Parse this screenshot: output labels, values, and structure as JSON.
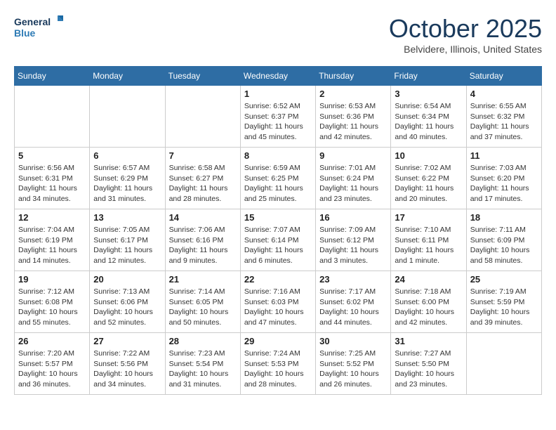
{
  "header": {
    "logo_line1": "General",
    "logo_line2": "Blue",
    "month": "October 2025",
    "location": "Belvidere, Illinois, United States"
  },
  "days_of_week": [
    "Sunday",
    "Monday",
    "Tuesday",
    "Wednesday",
    "Thursday",
    "Friday",
    "Saturday"
  ],
  "weeks": [
    [
      {
        "day": "",
        "info": ""
      },
      {
        "day": "",
        "info": ""
      },
      {
        "day": "",
        "info": ""
      },
      {
        "day": "1",
        "info": "Sunrise: 6:52 AM\nSunset: 6:37 PM\nDaylight: 11 hours\nand 45 minutes."
      },
      {
        "day": "2",
        "info": "Sunrise: 6:53 AM\nSunset: 6:36 PM\nDaylight: 11 hours\nand 42 minutes."
      },
      {
        "day": "3",
        "info": "Sunrise: 6:54 AM\nSunset: 6:34 PM\nDaylight: 11 hours\nand 40 minutes."
      },
      {
        "day": "4",
        "info": "Sunrise: 6:55 AM\nSunset: 6:32 PM\nDaylight: 11 hours\nand 37 minutes."
      }
    ],
    [
      {
        "day": "5",
        "info": "Sunrise: 6:56 AM\nSunset: 6:31 PM\nDaylight: 11 hours\nand 34 minutes."
      },
      {
        "day": "6",
        "info": "Sunrise: 6:57 AM\nSunset: 6:29 PM\nDaylight: 11 hours\nand 31 minutes."
      },
      {
        "day": "7",
        "info": "Sunrise: 6:58 AM\nSunset: 6:27 PM\nDaylight: 11 hours\nand 28 minutes."
      },
      {
        "day": "8",
        "info": "Sunrise: 6:59 AM\nSunset: 6:25 PM\nDaylight: 11 hours\nand 25 minutes."
      },
      {
        "day": "9",
        "info": "Sunrise: 7:01 AM\nSunset: 6:24 PM\nDaylight: 11 hours\nand 23 minutes."
      },
      {
        "day": "10",
        "info": "Sunrise: 7:02 AM\nSunset: 6:22 PM\nDaylight: 11 hours\nand 20 minutes."
      },
      {
        "day": "11",
        "info": "Sunrise: 7:03 AM\nSunset: 6:20 PM\nDaylight: 11 hours\nand 17 minutes."
      }
    ],
    [
      {
        "day": "12",
        "info": "Sunrise: 7:04 AM\nSunset: 6:19 PM\nDaylight: 11 hours\nand 14 minutes."
      },
      {
        "day": "13",
        "info": "Sunrise: 7:05 AM\nSunset: 6:17 PM\nDaylight: 11 hours\nand 12 minutes."
      },
      {
        "day": "14",
        "info": "Sunrise: 7:06 AM\nSunset: 6:16 PM\nDaylight: 11 hours\nand 9 minutes."
      },
      {
        "day": "15",
        "info": "Sunrise: 7:07 AM\nSunset: 6:14 PM\nDaylight: 11 hours\nand 6 minutes."
      },
      {
        "day": "16",
        "info": "Sunrise: 7:09 AM\nSunset: 6:12 PM\nDaylight: 11 hours\nand 3 minutes."
      },
      {
        "day": "17",
        "info": "Sunrise: 7:10 AM\nSunset: 6:11 PM\nDaylight: 11 hours\nand 1 minute."
      },
      {
        "day": "18",
        "info": "Sunrise: 7:11 AM\nSunset: 6:09 PM\nDaylight: 10 hours\nand 58 minutes."
      }
    ],
    [
      {
        "day": "19",
        "info": "Sunrise: 7:12 AM\nSunset: 6:08 PM\nDaylight: 10 hours\nand 55 minutes."
      },
      {
        "day": "20",
        "info": "Sunrise: 7:13 AM\nSunset: 6:06 PM\nDaylight: 10 hours\nand 52 minutes."
      },
      {
        "day": "21",
        "info": "Sunrise: 7:14 AM\nSunset: 6:05 PM\nDaylight: 10 hours\nand 50 minutes."
      },
      {
        "day": "22",
        "info": "Sunrise: 7:16 AM\nSunset: 6:03 PM\nDaylight: 10 hours\nand 47 minutes."
      },
      {
        "day": "23",
        "info": "Sunrise: 7:17 AM\nSunset: 6:02 PM\nDaylight: 10 hours\nand 44 minutes."
      },
      {
        "day": "24",
        "info": "Sunrise: 7:18 AM\nSunset: 6:00 PM\nDaylight: 10 hours\nand 42 minutes."
      },
      {
        "day": "25",
        "info": "Sunrise: 7:19 AM\nSunset: 5:59 PM\nDaylight: 10 hours\nand 39 minutes."
      }
    ],
    [
      {
        "day": "26",
        "info": "Sunrise: 7:20 AM\nSunset: 5:57 PM\nDaylight: 10 hours\nand 36 minutes."
      },
      {
        "day": "27",
        "info": "Sunrise: 7:22 AM\nSunset: 5:56 PM\nDaylight: 10 hours\nand 34 minutes."
      },
      {
        "day": "28",
        "info": "Sunrise: 7:23 AM\nSunset: 5:54 PM\nDaylight: 10 hours\nand 31 minutes."
      },
      {
        "day": "29",
        "info": "Sunrise: 7:24 AM\nSunset: 5:53 PM\nDaylight: 10 hours\nand 28 minutes."
      },
      {
        "day": "30",
        "info": "Sunrise: 7:25 AM\nSunset: 5:52 PM\nDaylight: 10 hours\nand 26 minutes."
      },
      {
        "day": "31",
        "info": "Sunrise: 7:27 AM\nSunset: 5:50 PM\nDaylight: 10 hours\nand 23 minutes."
      },
      {
        "day": "",
        "info": ""
      }
    ]
  ]
}
